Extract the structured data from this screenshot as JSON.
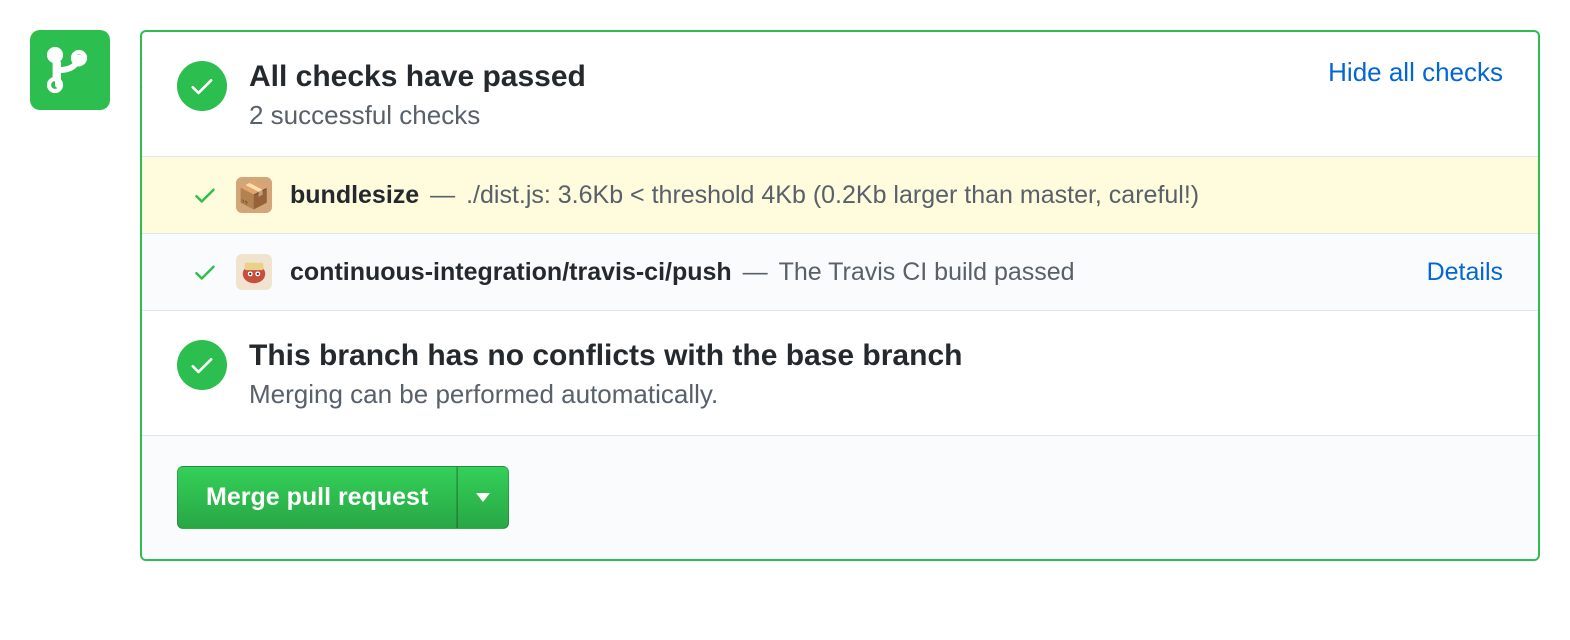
{
  "header": {
    "title": "All checks have passed",
    "subtitle": "2 successful checks",
    "toggle_link": "Hide all checks"
  },
  "checks": [
    {
      "name": "bundlesize",
      "description": "./dist.js: 3.6Kb < threshold 4Kb (0.2Kb larger than master, careful!)",
      "details": ""
    },
    {
      "name": "continuous-integration/travis-ci/push",
      "description": "The Travis CI build passed",
      "details": "Details"
    }
  ],
  "merge": {
    "title": "This branch has no conflicts with the base branch",
    "subtitle": "Merging can be performed automatically.",
    "button": "Merge pull request"
  }
}
